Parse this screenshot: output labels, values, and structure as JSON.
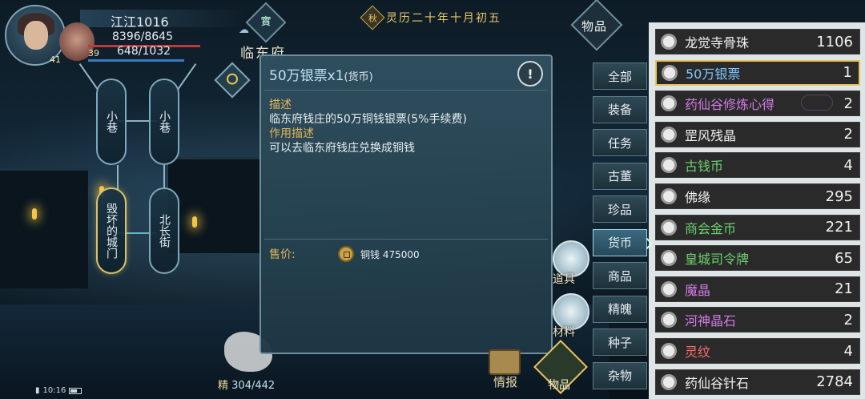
{
  "player": {
    "name": "江江1016",
    "hp": "8396/8645",
    "mp": "648/1032",
    "level_main": "41",
    "level_companion": "39",
    "stamina_label": "精",
    "stamina_value": "304/442"
  },
  "header": {
    "quest_icon_text": "實",
    "location": "临东府",
    "season_text": "秋",
    "date": "灵历二十年十月初五"
  },
  "map": {
    "nodes": [
      "小巷",
      "小巷",
      "毁坏的城门",
      "北长街"
    ]
  },
  "popup": {
    "title": "50万银票x1",
    "title_type": "(货币)",
    "desc_label": "描述",
    "desc_text": "临东府钱庄的50万铜钱银票(5%手续费)",
    "use_label": "作用描述",
    "use_text": "可以去临东府钱庄兑换成铜钱",
    "price_label": "售价:",
    "price_text": "铜钱 475000",
    "warn_symbol": "!"
  },
  "bottom_buttons": {
    "props_label": "道具",
    "material_label": "材料",
    "intel_label": "情报",
    "bag_label": "物品"
  },
  "inventory": {
    "title": "物品",
    "tabs": [
      "全部",
      "装备",
      "任务",
      "古董",
      "珍品",
      "货币",
      "商品",
      "精魄",
      "种子",
      "杂物"
    ],
    "active_tab_index": 5,
    "items": [
      {
        "name": "龙觉寺骨珠",
        "count": "1106",
        "color": "#f2f2f2"
      },
      {
        "name": "50万银票",
        "count": "1",
        "color": "#7ec8ff"
      },
      {
        "name": "药仙谷修炼心得",
        "count": "2",
        "color": "#d57ae8"
      },
      {
        "name": "罡风残晶",
        "count": "2",
        "color": "#f2f2f2"
      },
      {
        "name": "古钱币",
        "count": "4",
        "color": "#6ed16e"
      },
      {
        "name": "佛缘",
        "count": "295",
        "color": "#f2f2f2"
      },
      {
        "name": "商会金币",
        "count": "221",
        "color": "#6ed16e"
      },
      {
        "name": "皇城司令牌",
        "count": "65",
        "color": "#6ed16e"
      },
      {
        "name": "魔晶",
        "count": "21",
        "color": "#d57ae8"
      },
      {
        "name": "河神晶石",
        "count": "2",
        "color": "#d57ae8"
      },
      {
        "name": "灵纹",
        "count": "4",
        "color": "#ff6b6b"
      },
      {
        "name": "药仙谷针石",
        "count": "2784",
        "color": "#f2f2f2"
      }
    ],
    "selected_index": 1
  },
  "system": {
    "time": "10:16"
  },
  "icons": {
    "search": "magnifier-icon",
    "warn": "exclamation-icon",
    "coin": "copper-coin-icon",
    "item": "round-item-icon",
    "bag": "bag-icon"
  }
}
